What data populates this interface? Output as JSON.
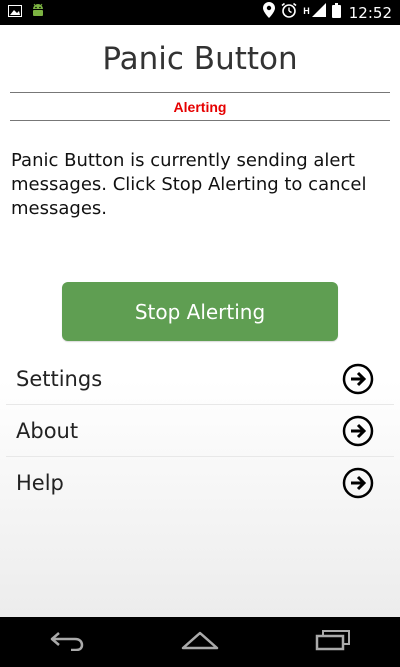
{
  "status_bar": {
    "time": "12:52",
    "network_letter": "H",
    "icons": [
      "image-notification-icon",
      "android-notification-icon",
      "location-icon",
      "alarm-icon",
      "signal-icon",
      "battery-icon"
    ]
  },
  "header": {
    "title": "Panic Button",
    "status": "Alerting"
  },
  "main": {
    "message": "Panic Button is currently sending alert messages. Click Stop Alerting to cancel messages.",
    "stop_button_label": "Stop Alerting"
  },
  "menu": {
    "items": [
      {
        "label": "Settings"
      },
      {
        "label": "About"
      },
      {
        "label": "Help"
      }
    ]
  },
  "colors": {
    "alert": "#e60000",
    "button": "#5f9e52"
  },
  "nav_bar": {
    "icons": [
      "back-icon",
      "home-icon",
      "recent-apps-icon"
    ]
  }
}
